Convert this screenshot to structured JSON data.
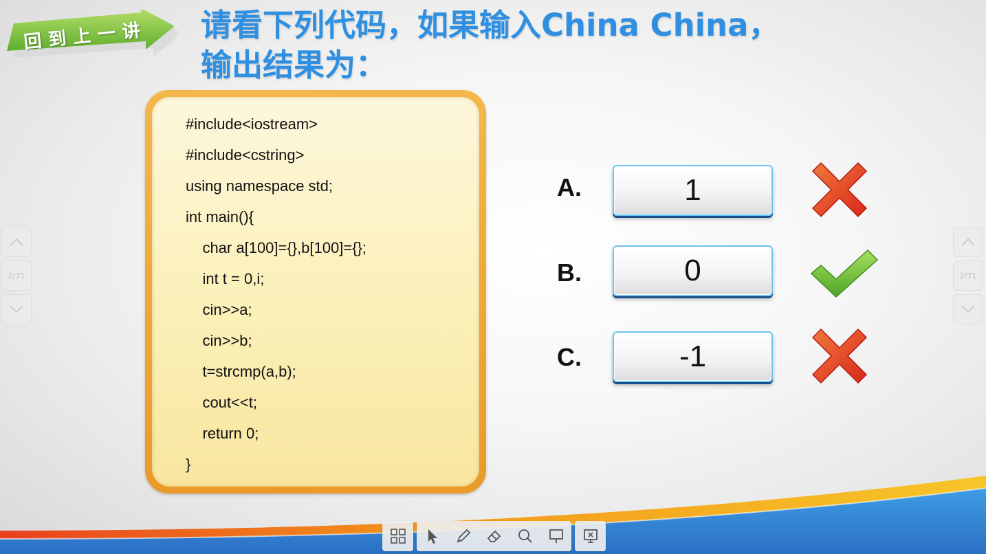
{
  "back_button": {
    "label": "回到上一讲"
  },
  "question": {
    "line1": "请看下列代码，如果输入China  China，",
    "line2": "输出结果为："
  },
  "code_lines": [
    "#include<iostream>",
    "#include<cstring>",
    "using namespace std;",
    "int main(){",
    "    char a[100]={},b[100]={};",
    "    int t = 0,i;",
    "    cin>>a;",
    "    cin>>b;",
    "    t=strcmp(a,b);",
    "    cout<<t;",
    "    return 0;",
    "}"
  ],
  "options": [
    {
      "letter": "A.",
      "value": "1",
      "result": "wrong"
    },
    {
      "letter": "B.",
      "value": "0",
      "result": "correct"
    },
    {
      "letter": "C.",
      "value": "-1",
      "result": "wrong"
    }
  ],
  "page_indicator": "2/71",
  "toolbar": {
    "icons": [
      "grid-icon",
      "pointer-icon",
      "pen-icon",
      "eraser-icon",
      "magnifier-icon",
      "spotlight-icon",
      "screen-icon"
    ]
  },
  "colors": {
    "title": "#2f8fe0",
    "banner_green": "#7cc243",
    "card_orange": "#e99a28",
    "option_border": "#6ec3f0",
    "wrong": "#e2452b",
    "correct": "#6cc13c"
  }
}
